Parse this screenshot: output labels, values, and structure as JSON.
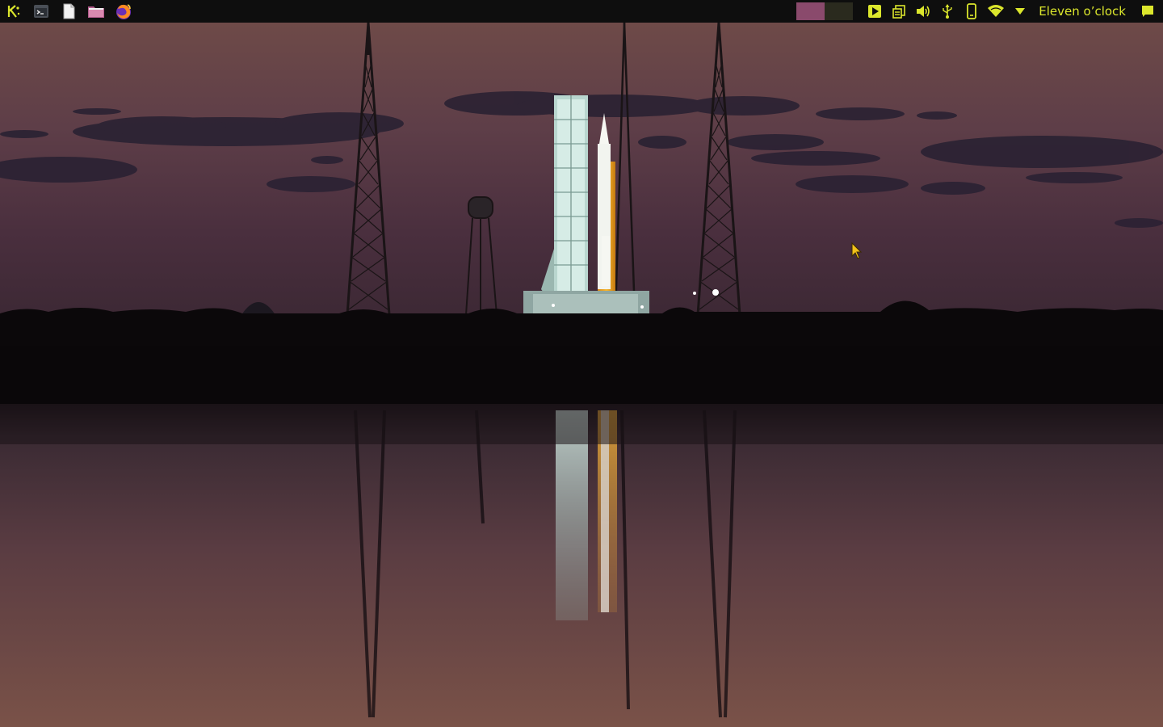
{
  "panel": {
    "launchers": [
      {
        "name": "app-menu",
        "icon": "kde-logo-icon"
      },
      {
        "name": "terminal",
        "icon": "terminal-icon"
      },
      {
        "name": "text-editor",
        "icon": "document-icon"
      },
      {
        "name": "file-manager",
        "icon": "folder-icon"
      },
      {
        "name": "firefox",
        "icon": "firefox-icon"
      }
    ],
    "pager": {
      "desktops": 2,
      "active_index": 0,
      "active_color": "#8a4a6c",
      "inactive_color": "#2a2a1e"
    },
    "tray_icons": [
      "media-player-icon",
      "clipboard-icon",
      "volume-icon",
      "usb-icon",
      "phone-icon",
      "wifi-icon",
      "expand-arrow-icon"
    ],
    "clock": "Eleven o’clock",
    "notifications_icon": "notification-icon"
  },
  "colors": {
    "panel_bg": "#0e0e0e",
    "accent": "#dbe62c"
  },
  "wallpaper": {
    "subject": "rocket-on-launch-pad-at-dusk"
  }
}
